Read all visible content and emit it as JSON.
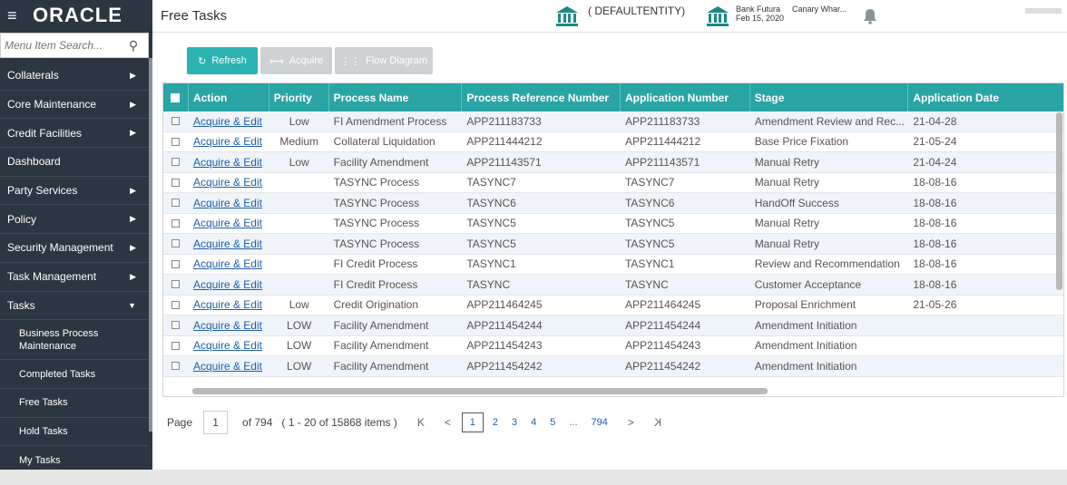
{
  "brand": {
    "logo": "ORACLE"
  },
  "sidebar": {
    "search_placeholder": "Menu Item Search...",
    "items": [
      {
        "label": "Collaterals",
        "arrow": "▶"
      },
      {
        "label": "Core Maintenance",
        "arrow": "▶"
      },
      {
        "label": "Credit Facilities",
        "arrow": "▶"
      },
      {
        "label": "Dashboard",
        "arrow": ""
      },
      {
        "label": "Party Services",
        "arrow": "▶"
      },
      {
        "label": "Policy",
        "arrow": "▶"
      },
      {
        "label": "Security Management",
        "arrow": "▶"
      },
      {
        "label": "Task Management",
        "arrow": "▶"
      },
      {
        "label": "Tasks",
        "arrow": "▼"
      }
    ],
    "subitems": [
      {
        "label": "Business Process Maintenance"
      },
      {
        "label": "Completed Tasks"
      },
      {
        "label": "Free Tasks"
      },
      {
        "label": "Hold Tasks"
      },
      {
        "label": "My Tasks"
      }
    ]
  },
  "header": {
    "title": "Free Tasks",
    "entity": "( DEFAULTENTITY)",
    "bank_name": "Bank Futura",
    "bank_date": "Feb 15, 2020",
    "branch": "Canary Whar..."
  },
  "toolbar": {
    "refresh_label": "Refresh",
    "acquire_label": "Acquire",
    "flow_label": "Flow Diagram"
  },
  "grid": {
    "columns": [
      "Action",
      "Priority",
      "Process Name",
      "Process Reference Number",
      "Application Number",
      "Stage",
      "Application Date"
    ],
    "rows": [
      {
        "action": "Acquire & Edit",
        "priority": "Low",
        "process": "FI Amendment Process",
        "ref": "APP211183733",
        "app": "APP211183733",
        "stage": "Amendment Review and Rec...",
        "date": "21-04-28"
      },
      {
        "action": "Acquire & Edit",
        "priority": "Medium",
        "process": "Collateral Liquidation",
        "ref": "APP211444212",
        "app": "APP211444212",
        "stage": "Base Price Fixation",
        "date": "21-05-24"
      },
      {
        "action": "Acquire & Edit",
        "priority": "Low",
        "process": "Facility Amendment",
        "ref": "APP211143571",
        "app": "APP211143571",
        "stage": "Manual Retry",
        "date": "21-04-24"
      },
      {
        "action": "Acquire & Edit",
        "priority": "",
        "process": "TASYNC Process",
        "ref": "TASYNC7",
        "app": "TASYNC7",
        "stage": "Manual Retry",
        "date": "18-08-16"
      },
      {
        "action": "Acquire & Edit",
        "priority": "",
        "process": "TASYNC Process",
        "ref": "TASYNC6",
        "app": "TASYNC6",
        "stage": "HandOff Success",
        "date": "18-08-16"
      },
      {
        "action": "Acquire & Edit",
        "priority": "",
        "process": "TASYNC Process",
        "ref": "TASYNC5",
        "app": "TASYNC5",
        "stage": "Manual Retry",
        "date": "18-08-16"
      },
      {
        "action": "Acquire & Edit",
        "priority": "",
        "process": "TASYNC Process",
        "ref": "TASYNC5",
        "app": "TASYNC5",
        "stage": "Manual Retry",
        "date": "18-08-16"
      },
      {
        "action": "Acquire & Edit",
        "priority": "",
        "process": "FI Credit Process",
        "ref": "TASYNC1",
        "app": "TASYNC1",
        "stage": "Review and Recommendation",
        "date": "18-08-16"
      },
      {
        "action": "Acquire & Edit",
        "priority": "",
        "process": "FI Credit Process",
        "ref": "TASYNC",
        "app": "TASYNC",
        "stage": "Customer Acceptance",
        "date": "18-08-16"
      },
      {
        "action": "Acquire & Edit",
        "priority": "Low",
        "process": "Credit Origination",
        "ref": "APP211464245",
        "app": "APP211464245",
        "stage": "Proposal Enrichment",
        "date": "21-05-26"
      },
      {
        "action": "Acquire & Edit",
        "priority": "LOW",
        "process": "Facility Amendment",
        "ref": "APP211454244",
        "app": "APP211454244",
        "stage": "Amendment Initiation",
        "date": ""
      },
      {
        "action": "Acquire & Edit",
        "priority": "LOW",
        "process": "Facility Amendment",
        "ref": "APP211454243",
        "app": "APP211454243",
        "stage": "Amendment Initiation",
        "date": ""
      },
      {
        "action": "Acquire & Edit",
        "priority": "LOW",
        "process": "Facility Amendment",
        "ref": "APP211454242",
        "app": "APP211454242",
        "stage": "Amendment Initiation",
        "date": ""
      }
    ]
  },
  "pager": {
    "page_label": "Page",
    "current": "1",
    "of_total": "of 794",
    "range": "( 1 - 20 of 15868 items )",
    "first": "K",
    "prev": "<",
    "pages": [
      "1",
      "2",
      "3",
      "4",
      "5",
      "...",
      "794"
    ],
    "next": ">",
    "last": "K"
  },
  "colors": {
    "sidebar": "#2c3640",
    "accent": "#2aa5a5",
    "link": "#1f5fa8"
  }
}
